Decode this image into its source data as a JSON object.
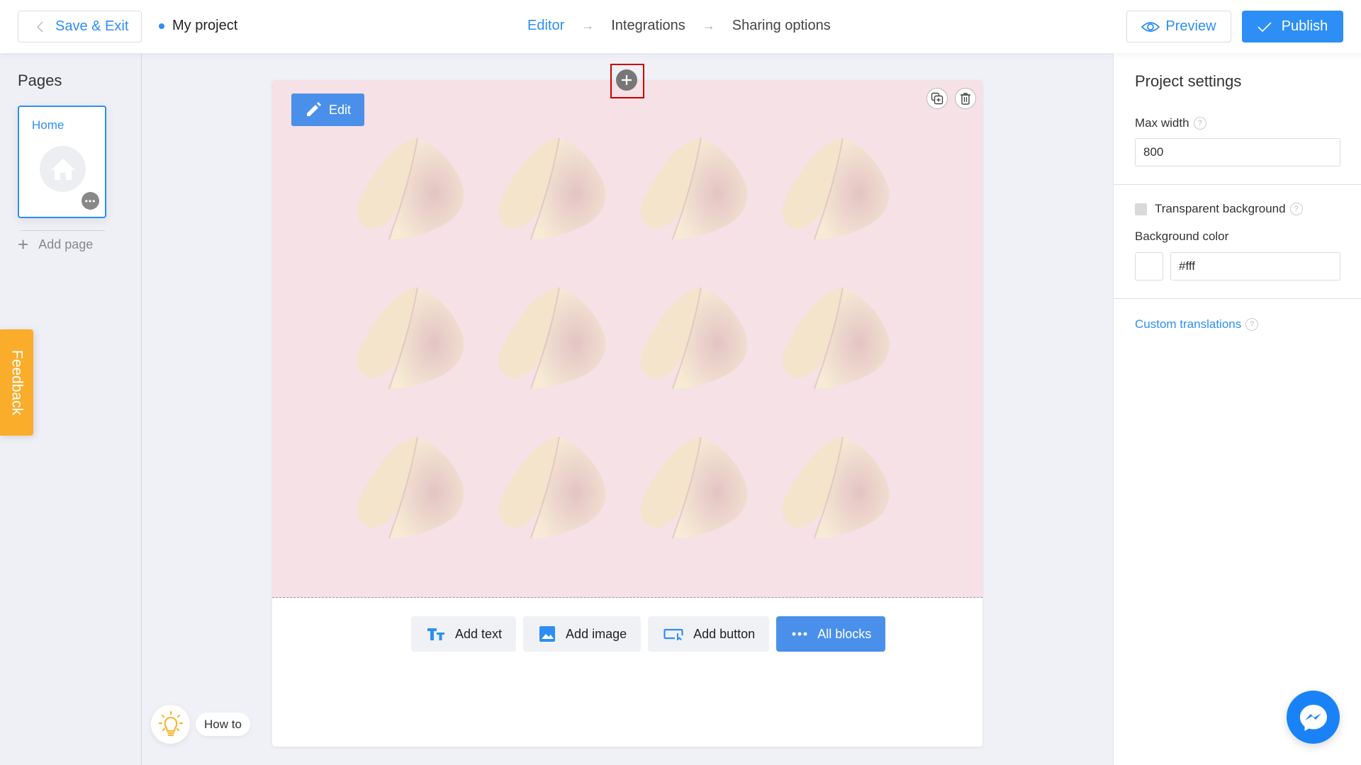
{
  "header": {
    "save_exit_label": "Save & Exit",
    "project_name": "My project",
    "steps": [
      {
        "label": "Editor",
        "active": true
      },
      {
        "label": "Integrations",
        "active": false
      },
      {
        "label": "Sharing options",
        "active": false
      }
    ],
    "step_arrow": "→",
    "preview_label": "Preview",
    "publish_label": "Publish"
  },
  "sidebar": {
    "title": "Pages",
    "pages": [
      {
        "label": "Home",
        "icon": "home-icon",
        "selected": true
      }
    ],
    "more_glyph": "•••",
    "add_page_label": "Add page",
    "add_page_glyph": "+"
  },
  "feedback_label": "Feedback",
  "canvas": {
    "edit_label": "Edit",
    "hero_background": "#f5e1e6",
    "image_grid": {
      "rows": 3,
      "cols": 4,
      "item": "fortune-cookie"
    },
    "toolbar": [
      {
        "label": "Add text",
        "icon": "text-icon",
        "primary": false
      },
      {
        "label": "Add image",
        "icon": "image-icon",
        "primary": false
      },
      {
        "label": "Add button",
        "icon": "button-icon",
        "primary": false
      },
      {
        "label": "All blocks",
        "icon": "dots-icon",
        "primary": true
      }
    ]
  },
  "howto_label": "How to",
  "settings": {
    "title": "Project settings",
    "max_width_label": "Max width",
    "max_width_value": "800",
    "transparent_bg_label": "Transparent background",
    "transparent_bg_checked": false,
    "bg_color_label": "Background color",
    "bg_color_value": "#fff",
    "custom_translations_label": "Custom translations",
    "help_glyph": "?"
  },
  "colors": {
    "accent": "#2d8ef5",
    "primary_button": "#4a90ea",
    "feedback": "#f9ad2b",
    "messenger": "#1a82f7"
  }
}
